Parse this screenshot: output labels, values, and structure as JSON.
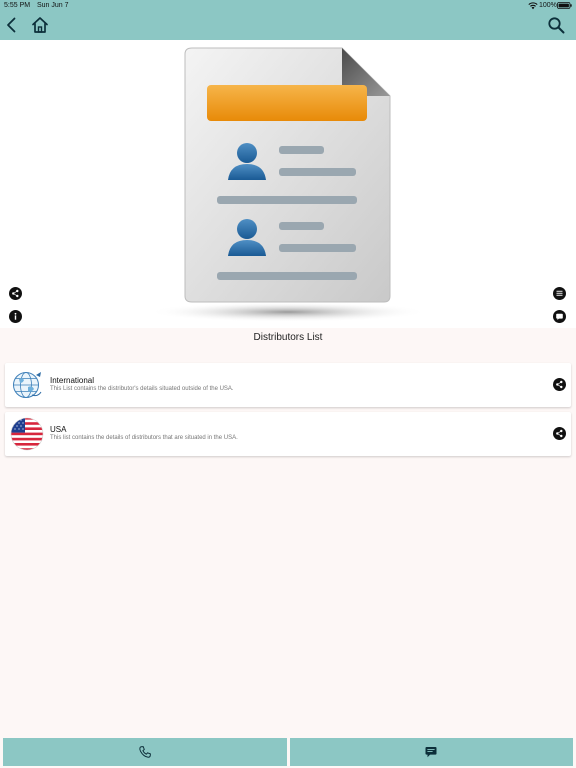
{
  "status_bar": {
    "time": "5:55 PM",
    "date": "Sun Jun 7",
    "battery": "100%"
  },
  "nav": {
    "back_icon": "chevron-left-icon",
    "home_icon": "home-icon",
    "search_icon": "search-icon"
  },
  "hero": {
    "image": "contact-document-illustration",
    "actions": [
      "share-icon",
      "info-icon",
      "list-icon",
      "chat-icon"
    ]
  },
  "section": {
    "title": "Distributors List"
  },
  "items": [
    {
      "title": "International",
      "description": "This List contains the distributor's details situated outside of the USA.",
      "icon": "globe-icon"
    },
    {
      "title": "USA",
      "description": "This list contains the details of distributors that are situated in the USA.",
      "icon": "us-flag-icon"
    }
  ],
  "bottom_bar": {
    "call_icon": "phone-icon",
    "message_icon": "message-icon"
  },
  "colors": {
    "accent": "#8cc7c4",
    "background": "#fdf7f6",
    "card": "#ffffff",
    "orange": "#f09a1a"
  }
}
